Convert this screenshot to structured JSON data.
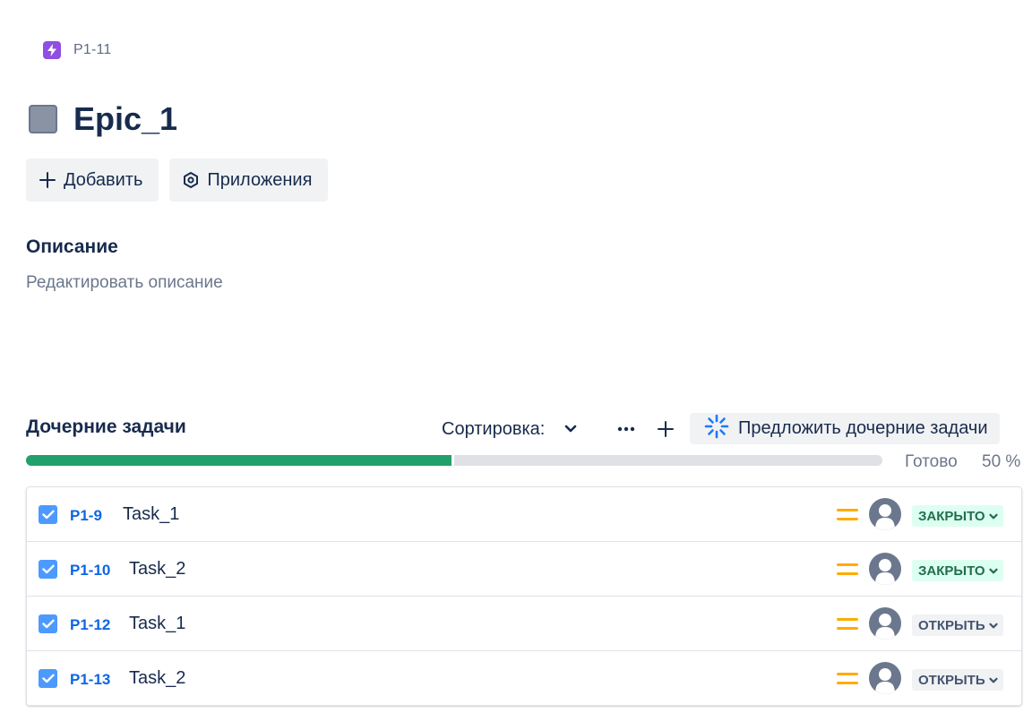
{
  "breadcrumb": {
    "issue_key": "P1-11",
    "icon": "epic-lightning-icon"
  },
  "issue": {
    "title": "Epic_1",
    "type_icon": "epic-square-icon"
  },
  "actions": {
    "add_label": "Добавить",
    "apps_label": "Приложения"
  },
  "description": {
    "heading": "Описание",
    "placeholder": "Редактировать описание"
  },
  "child_issues": {
    "heading": "Дочерние задачи",
    "sort_label": "Сортировка:",
    "suggest_label": "Предложить дочерние задачи",
    "progress": {
      "label": "Готово",
      "value_text": "50 %",
      "fraction": 0.5
    },
    "items": [
      {
        "key": "P1-9",
        "summary": "Task_1",
        "checked": true,
        "priority": "medium",
        "status": "ЗАКРЫТО",
        "status_type": "closed"
      },
      {
        "key": "P1-10",
        "summary": "Task_2",
        "checked": true,
        "priority": "medium",
        "status": "ЗАКРЫТО",
        "status_type": "closed"
      },
      {
        "key": "P1-12",
        "summary": "Task_1",
        "checked": true,
        "priority": "medium",
        "status": "ОТКРЫТЬ",
        "status_type": "open"
      },
      {
        "key": "P1-13",
        "summary": "Task_2",
        "checked": true,
        "priority": "medium",
        "status": "ОТКРЫТЬ",
        "status_type": "open"
      }
    ]
  },
  "colors": {
    "epic_purple": "#904ee2",
    "progress_done": "#22a06b",
    "progress_track": "#dfe1e6",
    "link_blue": "#0c66e4",
    "checkbox_blue": "#4c9aff",
    "priority_medium": "#ffab00",
    "status_closed_bg": "#dcfff1",
    "status_closed_text": "#216e4e",
    "status_open_bg": "#f1f2f4",
    "status_open_text": "#44546f"
  }
}
